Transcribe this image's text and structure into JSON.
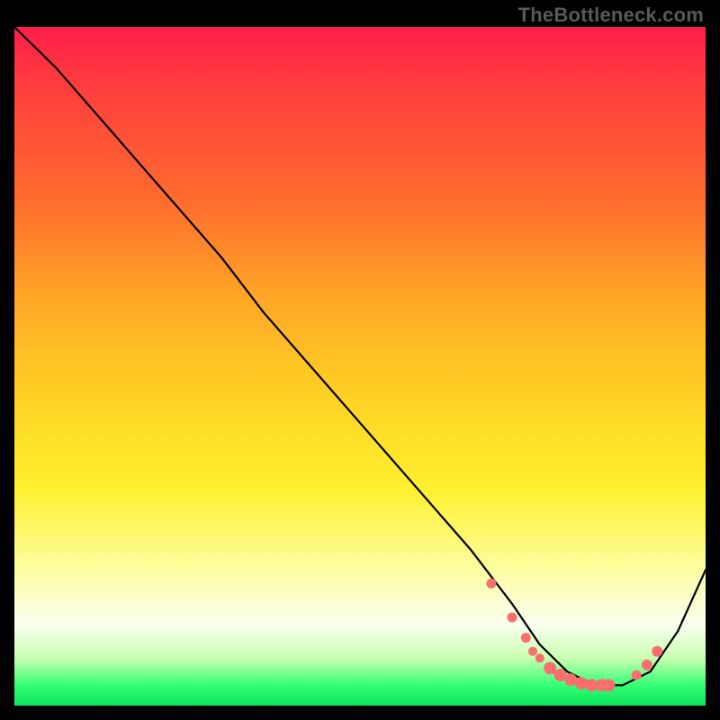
{
  "watermark": "TheBottleneck.com",
  "colors": {
    "dot": "#fa6e6e",
    "line": "#000000"
  },
  "chart_data": {
    "type": "line",
    "title": "",
    "xlabel": "",
    "ylabel": "",
    "xlim": [
      0,
      100
    ],
    "ylim": [
      0,
      100
    ],
    "grid": false,
    "legend": false,
    "series": [
      {
        "name": "curve",
        "x": [
          0,
          6,
          12,
          18,
          24,
          30,
          36,
          42,
          48,
          54,
          60,
          66,
          72,
          76,
          80,
          84,
          88,
          92,
          96,
          100
        ],
        "values": [
          100,
          94,
          87,
          80,
          73,
          66,
          58,
          51,
          44,
          37,
          30,
          23,
          15,
          9,
          5,
          3,
          3,
          5,
          11,
          20
        ]
      }
    ],
    "markers": {
      "name": "dots",
      "x": [
        69,
        72,
        74,
        75,
        76,
        77.5,
        79,
        80.5,
        82,
        83.5,
        85,
        86,
        90,
        91.5,
        93
      ],
      "values": [
        18,
        13,
        10,
        8,
        7,
        5.5,
        4.5,
        3.8,
        3.3,
        3.0,
        3.0,
        3.0,
        4.5,
        6.0,
        8.0
      ],
      "r": [
        5.5,
        5.5,
        5.5,
        5.0,
        5.0,
        7.0,
        7.0,
        7.0,
        7.0,
        7.0,
        7.0,
        7.0,
        5.5,
        6.0,
        6.0
      ]
    }
  }
}
